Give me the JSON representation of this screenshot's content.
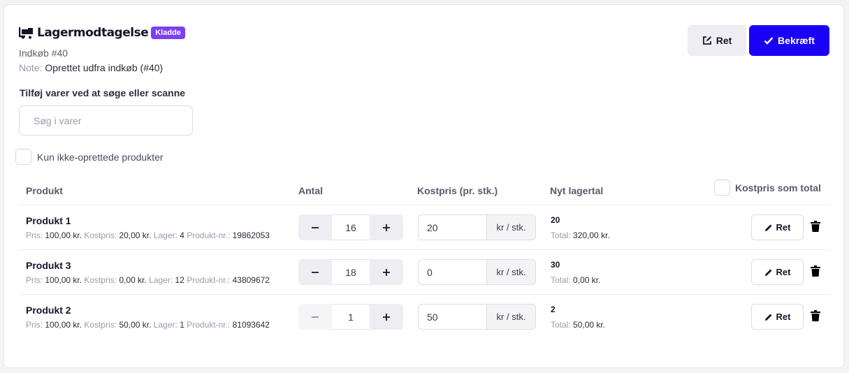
{
  "header": {
    "title": "Lagermodtagelse",
    "badge": "Kladde",
    "purchase": "Indkøb #40",
    "note_label": "Note:",
    "note_value": "Oprettet udfra indkøb (#40)",
    "icon": "forklift-icon"
  },
  "actions": {
    "edit_label": "Ret",
    "confirm_label": "Bekræft",
    "confirm_color": "#1a00f5"
  },
  "search": {
    "label": "Tilføj varer ved at søge eller scanne",
    "placeholder": "Søg i varer"
  },
  "filter": {
    "label": "Kun ikke-oprettede produkter",
    "checked": false
  },
  "table": {
    "headers": {
      "product": "Produkt",
      "quantity": "Antal",
      "cost": "Kostpris (pr. stk.)",
      "new_stock": "Nyt lagertal",
      "cost_total": "Kostpris som total"
    },
    "labels": {
      "price": "Pris:",
      "cost": "Kostpris:",
      "stock": "Lager:",
      "product_no": "Produkt-nr.:",
      "unit": "kr / stk.",
      "total": "Total:",
      "edit": "Ret"
    },
    "rows": [
      {
        "name": "Produkt 1",
        "price": "100,00 kr.",
        "cost": "20,00 kr.",
        "stock": "4",
        "product_no": "19862053",
        "quantity": "16",
        "cost_value": "20",
        "new_stock": "20",
        "total": "320,00 kr."
      },
      {
        "name": "Produkt 3",
        "price": "100,00 kr.",
        "cost": "0,00 kr.",
        "stock": "12",
        "product_no": "43809672",
        "quantity": "18",
        "cost_value": "0",
        "new_stock": "30",
        "total": "0,00 kr."
      },
      {
        "name": "Produkt 2",
        "price": "100,00 kr.",
        "cost": "50,00 kr.",
        "stock": "1",
        "product_no": "81093642",
        "quantity": "1",
        "cost_value": "50",
        "new_stock": "2",
        "total": "50,00 kr."
      }
    ]
  }
}
